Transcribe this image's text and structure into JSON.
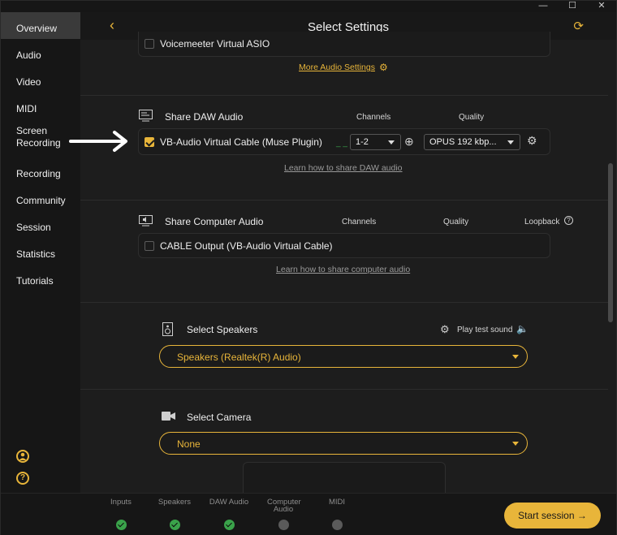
{
  "window": {
    "minimize": "—",
    "maximize": "☐",
    "close": "✕"
  },
  "sidebar": {
    "items": [
      {
        "label": "Overview"
      },
      {
        "label": "Audio"
      },
      {
        "label": "Video"
      },
      {
        "label": "MIDI"
      },
      {
        "label": "Screen\nRecording"
      },
      {
        "label": "Recording"
      },
      {
        "label": "Community"
      },
      {
        "label": "Session"
      },
      {
        "label": "Statistics"
      },
      {
        "label": "Tutorials"
      }
    ],
    "active": "Overview"
  },
  "header": {
    "title": "Select Settings",
    "back_icon": "chevron-left-icon",
    "refresh_icon": "refresh-icon"
  },
  "asio": {
    "label": "Voicemeeter Virtual ASIO",
    "more_link": "More Audio Settings"
  },
  "daw": {
    "title": "Share DAW Audio",
    "col_channels": "Channels",
    "col_quality": "Quality",
    "device": "VB-Audio Virtual Cable (Muse Plugin)",
    "checked": true,
    "level": "_ _",
    "channels": "1-2",
    "quality": "OPUS 192 kbp...",
    "learn_link": "Learn how to share DAW audio"
  },
  "computer_audio": {
    "title": "Share Computer Audio",
    "col_channels": "Channels",
    "col_quality": "Quality",
    "col_loopback": "Loopback",
    "device": "CABLE Output (VB-Audio Virtual Cable)",
    "checked": false,
    "learn_link": "Learn how to share computer audio"
  },
  "speakers": {
    "title": "Select Speakers",
    "play_test": "Play test sound",
    "selected": "Speakers (Realtek(R) Audio)"
  },
  "camera": {
    "title": "Select Camera",
    "selected": "None"
  },
  "steps": [
    {
      "label": "Inputs",
      "done": true
    },
    {
      "label": "Speakers",
      "done": true
    },
    {
      "label": "DAW Audio",
      "done": true
    },
    {
      "label": "Computer Audio",
      "done": false
    },
    {
      "label": "MIDI",
      "done": false
    }
  ],
  "start_button": "Start session",
  "colors": {
    "accent": "#e8b53a",
    "success": "#3aa24a"
  }
}
